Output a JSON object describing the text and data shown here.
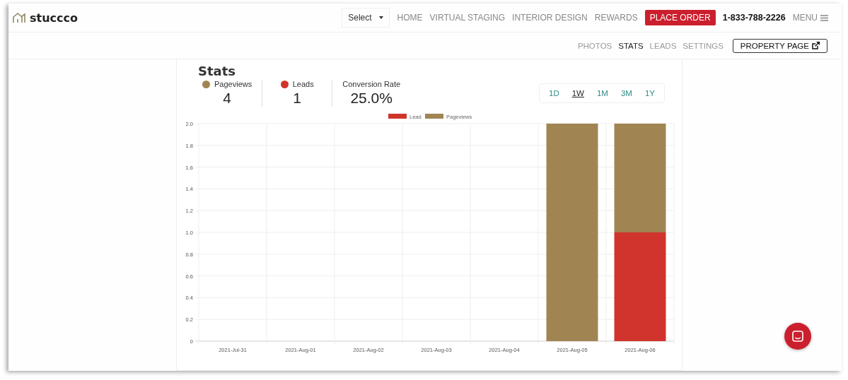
{
  "header": {
    "logo": "stuccco",
    "select": "Select",
    "nav": [
      {
        "label": "HOME",
        "kind": "link"
      },
      {
        "label": "VIRTUAL STAGING",
        "kind": "link"
      },
      {
        "label": "INTERIOR DESIGN",
        "kind": "link"
      },
      {
        "label": "REWARDS",
        "kind": "link"
      },
      {
        "label": "PLACE ORDER",
        "kind": "cta"
      },
      {
        "label": "1-833-788-2226",
        "kind": "phone"
      }
    ],
    "menu": "MENU"
  },
  "subnav": {
    "tabs": [
      {
        "label": "PHOTOS",
        "selected": false
      },
      {
        "label": "STATS",
        "selected": true
      },
      {
        "label": "LEADS",
        "selected": false
      },
      {
        "label": "SETTINGS",
        "selected": false
      }
    ],
    "button": "PROPERTY PAGE"
  },
  "stats": {
    "title": "Stats",
    "metrics": [
      {
        "label": "Pageviews",
        "value": "4",
        "color": "#a08553"
      },
      {
        "label": "Leads",
        "value": "1",
        "color": "#d0342c"
      },
      {
        "label": "Conversion Rate",
        "value": "25.0%"
      }
    ],
    "ranges": [
      {
        "label": "1D",
        "selected": false
      },
      {
        "label": "1W",
        "selected": true
      },
      {
        "label": "1M",
        "selected": false
      },
      {
        "label": "3M",
        "selected": false
      },
      {
        "label": "1Y",
        "selected": false
      }
    ],
    "chart_data": {
      "type": "bar",
      "stacked": true,
      "grid": true,
      "legend": "top",
      "categories": [
        "2021-Jul-31",
        "2021-Aug-01",
        "2021-Aug-02",
        "2021-Aug-03",
        "2021-Aug-04",
        "2021-Aug-05",
        "2021-Aug-06"
      ],
      "ylim": [
        0,
        2
      ],
      "yticks": [
        {
          "value": 0,
          "label": "0"
        },
        {
          "value": 0.2,
          "label": "0.2"
        },
        {
          "value": 0.4,
          "label": "0.4"
        },
        {
          "value": 0.6,
          "label": "0.6"
        },
        {
          "value": 0.8,
          "label": "0.8"
        },
        {
          "value": 1,
          "label": "1.0"
        },
        {
          "value": 1.2,
          "label": "1.2"
        },
        {
          "value": 1.4,
          "label": "1.4"
        },
        {
          "value": 1.6,
          "label": "1.6"
        },
        {
          "value": 1.8,
          "label": "1.8"
        },
        {
          "value": 2,
          "label": "2.0"
        }
      ],
      "series": [
        {
          "name": "Lead",
          "color": "#d0342c",
          "values": [
            0,
            0,
            0,
            0,
            0,
            0,
            1
          ]
        },
        {
          "name": "Pageviews",
          "color": "#a08553",
          "values": [
            0,
            0,
            0,
            0,
            0,
            2,
            1
          ]
        }
      ]
    }
  }
}
